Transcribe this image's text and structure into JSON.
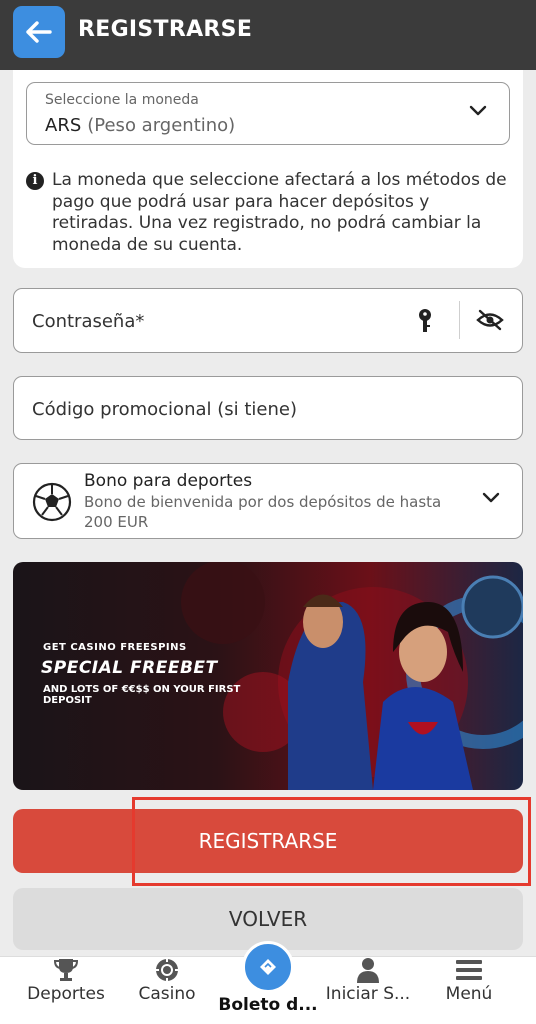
{
  "header": {
    "title": "REGISTRARSE",
    "back_icon": "arrow-left-icon"
  },
  "currency": {
    "label": "Seleccione la moneda",
    "code": "ARS",
    "name": "(Peso argentino)",
    "info": "La moneda que seleccione afectará a los métodos de pago que podrá usar para hacer depósitos y retiradas. Una vez registrado, no podrá cambiar la moneda de su cuenta."
  },
  "password": {
    "label": "Contraseña*"
  },
  "promo": {
    "label": "Código promocional (si tiene)"
  },
  "bonus": {
    "title": "Bono para deportes",
    "description": "Bono de bienvenida por dos depósitos de hasta 200 EUR"
  },
  "banner": {
    "line1": "GET CASINO FREESPINS",
    "line2": "SPECIAL FREEBET",
    "line3": "AND LOTS OF €€$$ ON YOUR FIRST DEPOSIT"
  },
  "buttons": {
    "register": "REGISTRARSE",
    "back": "VOLVER"
  },
  "nav": {
    "items": [
      {
        "label": "Deportes",
        "icon": "trophy-icon"
      },
      {
        "label": "Casino",
        "icon": "casino-chip-icon"
      },
      {
        "label": "Boleto d...",
        "icon": "ticket-icon"
      },
      {
        "label": "Iniciar S...",
        "icon": "user-icon"
      },
      {
        "label": "Menú",
        "icon": "menu-icon"
      }
    ]
  },
  "colors": {
    "accent": "#3d8ee0",
    "register": "#d84a3c",
    "highlight": "#e53a2e",
    "header": "#3b3b3b"
  }
}
